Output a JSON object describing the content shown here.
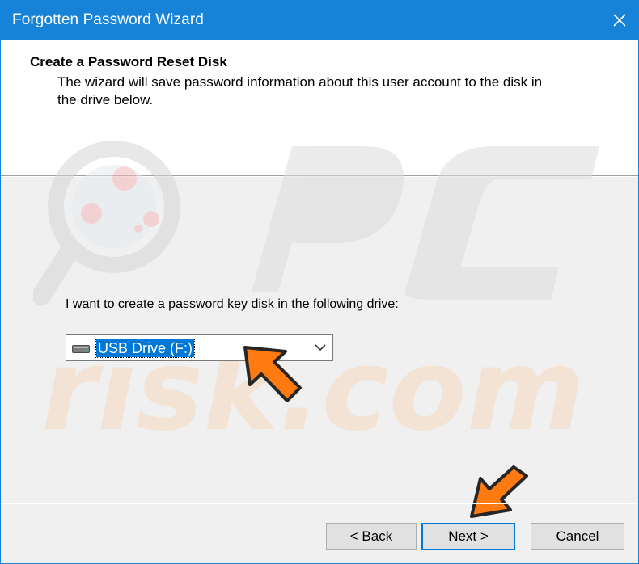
{
  "window": {
    "title": "Forgotten Password Wizard",
    "accent_color": "#1683d8",
    "close_icon": "close-icon"
  },
  "header": {
    "title": "Create a Password Reset Disk",
    "description": "The wizard will save password information about this user account to the disk in the drive below."
  },
  "content": {
    "prompt": "I want to create a password key disk in the following drive:",
    "drive_select": {
      "selected": "USB Drive (F:)",
      "icon": "drive-icon",
      "highlight_color": "#0078d7"
    }
  },
  "annotations": {
    "arrow_color": "#ff7a10",
    "arrows": [
      "pointer-arrow-drive",
      "pointer-arrow-next"
    ]
  },
  "watermark": {
    "brand": "PC risk.com"
  },
  "buttons": {
    "back": "< Back",
    "next": "Next >",
    "cancel": "Cancel"
  }
}
